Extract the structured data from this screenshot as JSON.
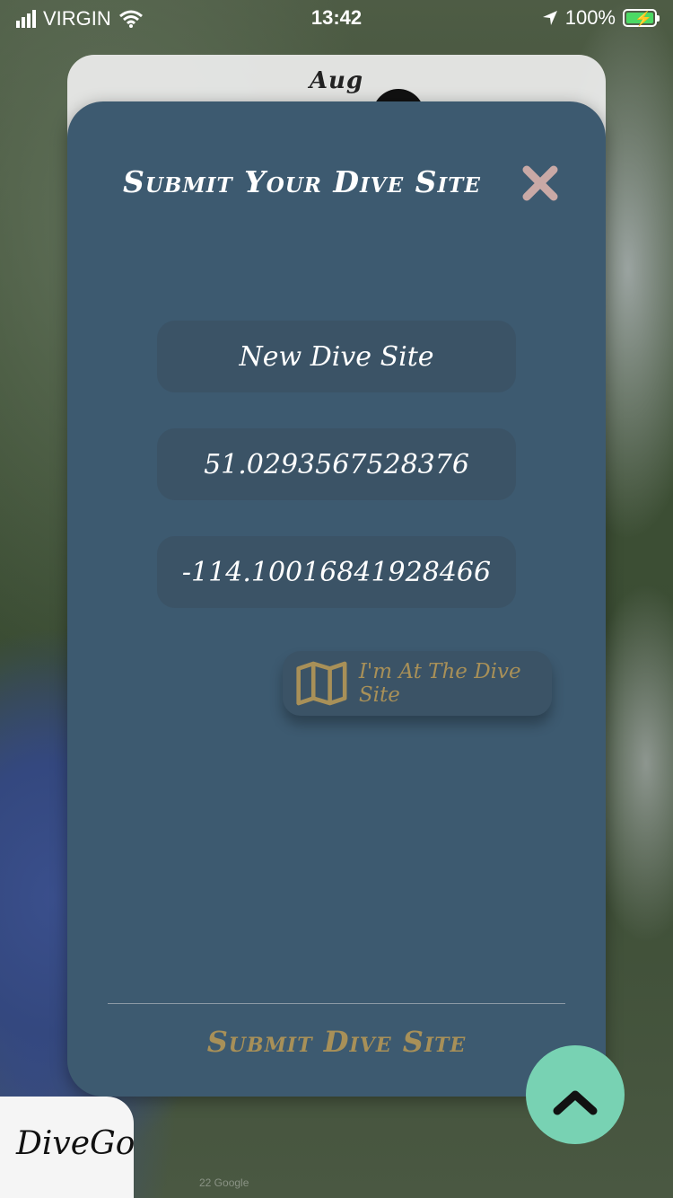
{
  "status_bar": {
    "carrier": "VIRGIN",
    "time": "13:42",
    "battery": "100%"
  },
  "background_card": {
    "title": "Aug"
  },
  "modal": {
    "title": "Submit Your Dive Site",
    "fields": {
      "site_name": "New Dive Site",
      "latitude": "51.0293567528376",
      "longitude": "-114.10016841928466"
    },
    "locate_button_label": "I'm At The Dive Site",
    "submit_label": "Submit Dive Site"
  },
  "brand": {
    "label": "DiveGo"
  },
  "map_credit": "22 Google",
  "colors": {
    "modal_bg": "#3d5a70",
    "field_bg": "#3b5366",
    "accent_gold": "#a89058",
    "close_icon": "#c9a9a6",
    "fab": "#78d2b3",
    "battery_fill": "#4cd964"
  },
  "icons": [
    "signal-icon",
    "wifi-icon",
    "location-arrow-icon",
    "battery-icon",
    "close-icon",
    "map-icon",
    "chevron-up-icon"
  ]
}
